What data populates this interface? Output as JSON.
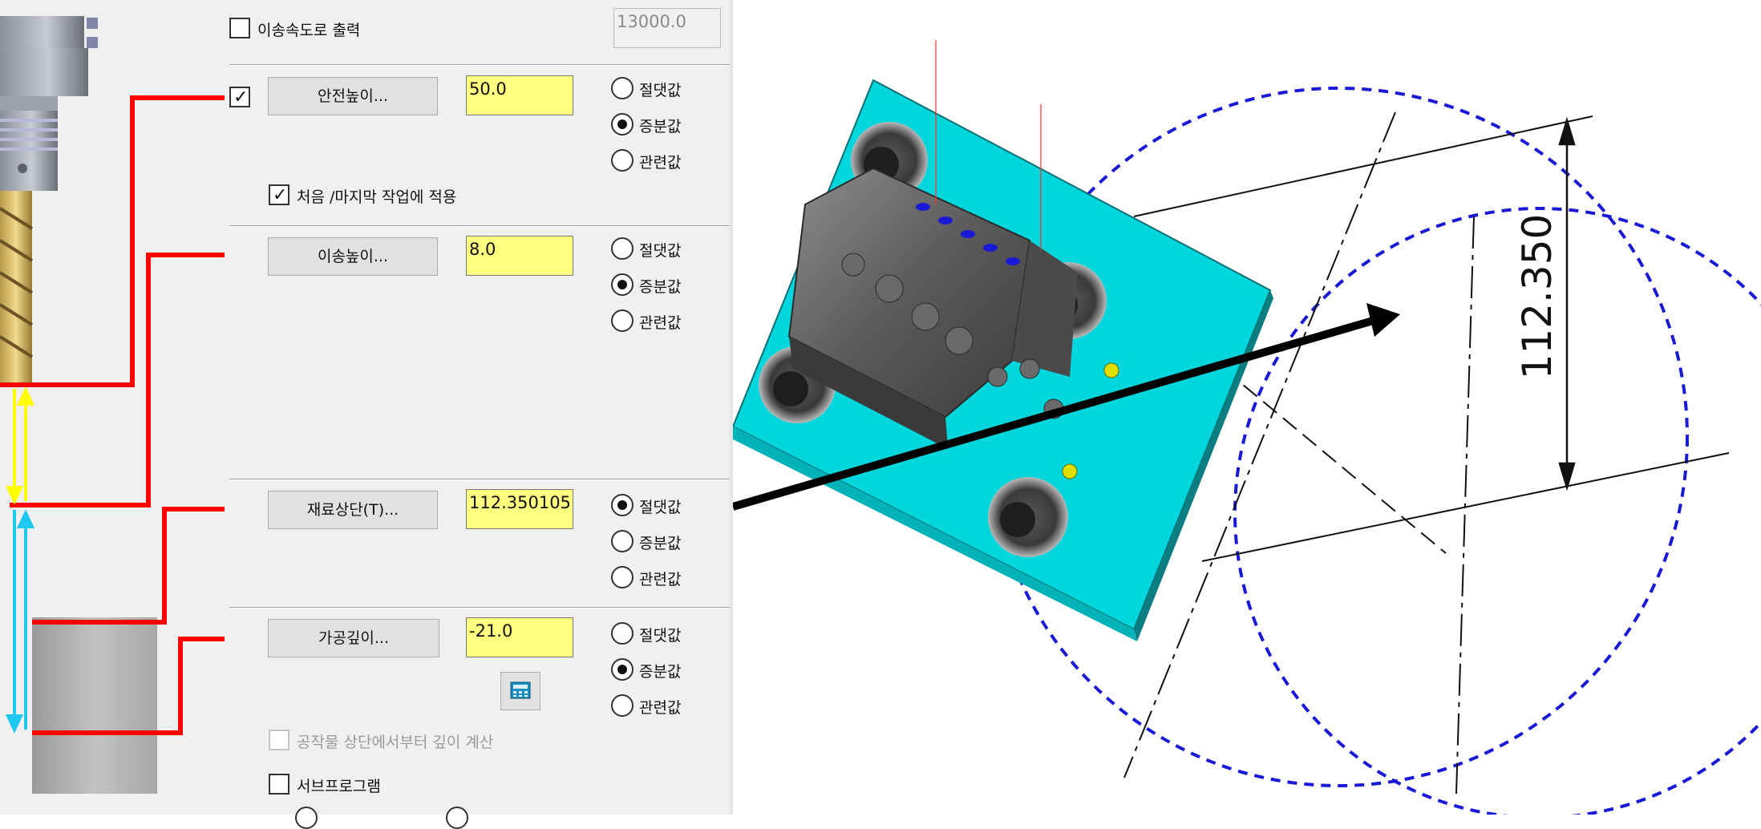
{
  "output_rate": {
    "label": "이송속도로 출력",
    "checked": false,
    "value": "13000.0"
  },
  "clearance": {
    "enabled": true,
    "button_label": "안전높이...",
    "value": "50.0",
    "options": [
      "절댓값",
      "증분값",
      "관련값"
    ],
    "selected": "증분값",
    "apply_first_last_label": "처음 /마지막 작업에 적용",
    "apply_first_last_checked": true
  },
  "retract": {
    "button_label": "이송높이...",
    "value": "8.0",
    "options": [
      "절댓값",
      "증분값",
      "관련값"
    ],
    "selected": "증분값"
  },
  "top_of_stock": {
    "button_label": "재료상단(T)...",
    "value": "112.350105",
    "options": [
      "절댓값",
      "증분값",
      "관련값"
    ],
    "selected": "절댓값"
  },
  "depth": {
    "button_label": "가공깊이...",
    "value": "-21.0",
    "options": [
      "절댓값",
      "증분값",
      "관련값"
    ],
    "selected": "증분값",
    "calc_depth_label": "공작물 상단에서부터 깊이 계산",
    "calc_depth_checked": false,
    "calc_depth_enabled": false
  },
  "subprogram": {
    "label": "서브프로그램",
    "checked": false
  },
  "cad": {
    "dimension_label": "112.350"
  },
  "icons": {
    "checkmark": "checkmark-icon",
    "calculator": "calculator-icon",
    "arrow": "arrow-icon"
  },
  "colors": {
    "field_yellow": "#ffff80",
    "clearance_red": "#ff0000",
    "feed_yellow": "#ffff00",
    "cut_cyan": "#1ec8f0",
    "part_cyan": "#00d6dc",
    "dashed_blue": "#1a1ad6"
  }
}
